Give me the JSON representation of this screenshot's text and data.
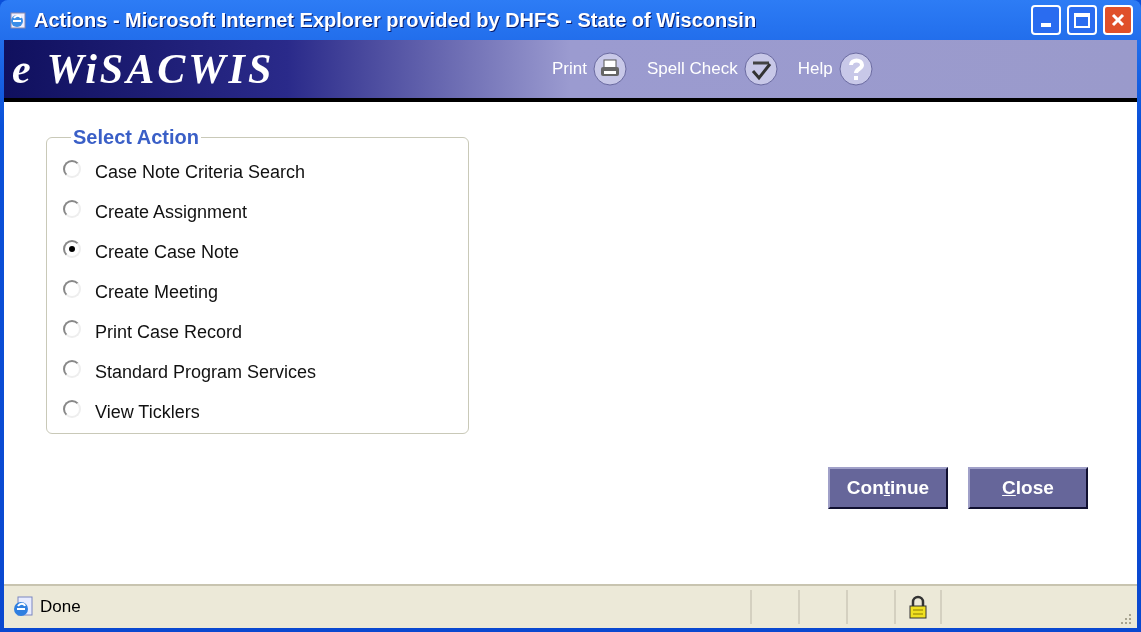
{
  "window": {
    "title": "Actions - Microsoft Internet Explorer provided by DHFS - State of Wisconsin"
  },
  "header": {
    "logo": "e WiSACWIS",
    "tools": [
      {
        "kind": "print",
        "label": "Print"
      },
      {
        "kind": "spell",
        "label": "Spell Check"
      },
      {
        "kind": "help",
        "label": "Help"
      }
    ]
  },
  "select_action": {
    "legend": "Select Action",
    "options": [
      {
        "label": "Case Note Criteria Search",
        "selected": false
      },
      {
        "label": "Create Assignment",
        "selected": false
      },
      {
        "label": "Create Case Note",
        "selected": true
      },
      {
        "label": "Create Meeting",
        "selected": false
      },
      {
        "label": "Print Case Record",
        "selected": false
      },
      {
        "label": "Standard Program Services",
        "selected": false
      },
      {
        "label": "View Ticklers",
        "selected": false
      }
    ]
  },
  "buttons": [
    {
      "before": "Con",
      "key": "t",
      "after": "inue"
    },
    {
      "key": "C",
      "after": "lose"
    }
  ],
  "status_bar": {
    "text": "Done",
    "secure": true
  }
}
